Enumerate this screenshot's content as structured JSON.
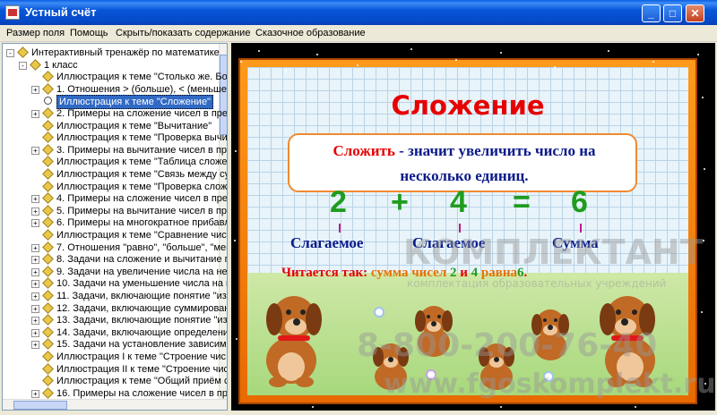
{
  "window": {
    "title": "Устный счёт",
    "minimize": "_",
    "maximize": "□",
    "close": "✕"
  },
  "menu": [
    "Размер поля",
    "Помощь",
    "Скрыть/показать содержание",
    "Сказочное образование"
  ],
  "tree": {
    "rows": [
      {
        "label": "Интерактивный тренажёр по математике",
        "indent": 0,
        "expander": "-"
      },
      {
        "label": "1 класс",
        "indent": 1,
        "expander": "-"
      },
      {
        "label": "Иллюстрация к теме \"Столько же. Бо",
        "indent": 2,
        "expander": ""
      },
      {
        "label": "1. Отношения > (больше), < (меньше),",
        "indent": 2,
        "expander": "+"
      },
      {
        "label": "Иллюстрация к теме \"Сложение\"",
        "indent": 2,
        "expander": "",
        "selected": true
      },
      {
        "label": "2. Примеры на сложение чисел в пред",
        "indent": 2,
        "expander": "+"
      },
      {
        "label": "Иллюстрация к теме \"Вычитание\"",
        "indent": 2,
        "expander": ""
      },
      {
        "label": "Иллюстрация к теме \"Проверка вычи",
        "indent": 2,
        "expander": ""
      },
      {
        "label": "3. Примеры на вычитание чисел в пре",
        "indent": 2,
        "expander": "+"
      },
      {
        "label": "Иллюстрация к теме \"Таблица сложе",
        "indent": 2,
        "expander": ""
      },
      {
        "label": "Иллюстрация к теме \"Связь между су",
        "indent": 2,
        "expander": ""
      },
      {
        "label": "Иллюстрация к теме \"Проверка слож",
        "indent": 2,
        "expander": ""
      },
      {
        "label": "4. Примеры на сложение чисел в пред",
        "indent": 2,
        "expander": "+"
      },
      {
        "label": "5. Примеры на вычитание чисел в пре",
        "indent": 2,
        "expander": "+"
      },
      {
        "label": "6. Примеры на многократное прибавл",
        "indent": 2,
        "expander": "+"
      },
      {
        "label": "Иллюстрация к теме \"Сравнение чис",
        "indent": 2,
        "expander": ""
      },
      {
        "label": "7. Отношения \"равно\", \"больше\", \"мен",
        "indent": 2,
        "expander": "+"
      },
      {
        "label": "8. Задачи на сложение и вычитание п",
        "indent": 2,
        "expander": "+"
      },
      {
        "label": "9. Задачи на увеличение числа на нес",
        "indent": 2,
        "expander": "+"
      },
      {
        "label": "10. Задачи на уменьшение числа на н",
        "indent": 2,
        "expander": "+"
      },
      {
        "label": "11. Задачи, включающие понятие \"из",
        "indent": 2,
        "expander": "+"
      },
      {
        "label": "12. Задачи, включающие суммирован",
        "indent": 2,
        "expander": "+"
      },
      {
        "label": "13. Задачи, включающие понятие \"из",
        "indent": 2,
        "expander": "+"
      },
      {
        "label": "14. Задачи, включающие определени",
        "indent": 2,
        "expander": "+"
      },
      {
        "label": "15. Задачи на установление зависим",
        "indent": 2,
        "expander": "+"
      },
      {
        "label": "Иллюстрация I к теме \"Строение чис",
        "indent": 2,
        "expander": ""
      },
      {
        "label": "Иллюстрация II к теме \"Строение чис",
        "indent": 2,
        "expander": ""
      },
      {
        "label": "Иллюстрация к теме \"Общий приём с",
        "indent": 2,
        "expander": ""
      },
      {
        "label": "16. Примеры на сложение чисел в пре",
        "indent": 2,
        "expander": "+"
      }
    ]
  },
  "lesson": {
    "heading": "Сложение",
    "definition_word": "Сложить",
    "definition_dash": "-",
    "definition_rest": "значит увеличить число на",
    "definition_line2": "несколько единиц.",
    "equation": {
      "a": "2",
      "plus": "+",
      "b": "4",
      "eq": "=",
      "result": "6"
    },
    "terms": {
      "addend1": "Слагаемое",
      "addend2": "Слагаемое",
      "sum": "Сумма"
    },
    "reads_prefix": "Читается так:",
    "reads_part1": "сумма чисел",
    "reads_a": "2",
    "reads_and": "и",
    "reads_b": "4",
    "reads_equal": "равна",
    "reads_result": "6",
    "reads_dot": "."
  },
  "watermark": {
    "brand": "КОМПЛЕКТАНТ",
    "tagline": "комплектация образовательных учреждений",
    "phone": "8-800-200-76-40",
    "site": "www.fgoskomplekt.ru"
  },
  "colors": {
    "titlebar": "#0856d8",
    "heading": "#e60000",
    "definition_text": "#0a1a8a",
    "equation": "#1f9c1f",
    "frame": "#ff8c00",
    "reads_highlight": "#e87000"
  }
}
